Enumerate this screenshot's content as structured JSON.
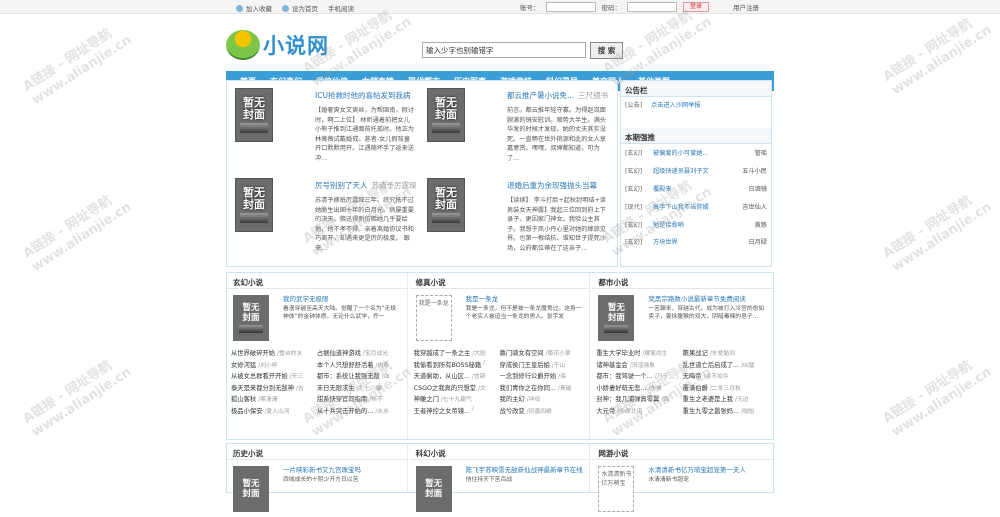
{
  "topbar": {
    "bookmark": "加入收藏",
    "home": "设为首页",
    "mobile": "手机阅读",
    "account_label": "账号：",
    "password_label": "密码：",
    "login": "登录",
    "register": "用户注册"
  },
  "logo": {
    "text": "小说网"
  },
  "search": {
    "value": "输入少字也别输错字",
    "button": "搜 索"
  },
  "nav": [
    "首页",
    "玄幻奇幻",
    "武侠仙侠",
    "女频言情",
    "现代都市",
    "历史军事",
    "游戏竞技",
    "科幻灵异",
    "美文同人",
    "其他类型"
  ],
  "cover": {
    "line1": "暂无",
    "line2": "封面"
  },
  "featured": [
    {
      "title": "ICU抢救时他的喜帖发到我病",
      "author": "",
      "desc": "【婚奢爽女文爽丝，为帮国南，假讨时，啊二上位】 林昕通着前把女儿小熊子推到江通面前托孤时。他正为林薇薇试戴婚戒。甚者-女儿假孩童开口默默用开。江遇随坏手了返来送冲..."
    },
    {
      "title": "都云推产暑小说免...",
      "author": "三尺镜书",
      "desc": "前言。都云推年轻守寡。为得赵岚面腕滚的镜安慰训。顺势大半生。满头华发的时候才发现。她的丈夫其实没死。一直畅在世外桃源和此的女人享嘉意赏。嘿嘿、叔婶都知道，可为了..."
    },
    {
      "title": "厉号别别了天人",
      "author": "苏清予厉霆琛",
      "desc": "苏清予嫁抵厉霆琛三年。终究抵不过她脆生出国十年的白月光。病屡重要的决天。佛迅得新仿佛她几乎要给他，他不孝不得。亲着离婚协议书和巧离开，却遇来更是厉的极度。 跟来..."
    },
    {
      "title": "退婚后重为余现强抛头当幕",
      "author": "",
      "desc": "【读续】 李斗打脸+起秋封明结+读男装女天神露】我起三位回到府上下录子。更因家门神女。我验公主其子。我想于凤小丹心里对她的嫁旅见界。也第一根结抗、谁知世子提死沙场，公府都位蒂在了这亲子..."
    }
  ],
  "notice": {
    "heading": "公告栏",
    "items": [
      {
        "cat": "[公告]",
        "text": "点击进入沙网举报"
      }
    ]
  },
  "recommend": {
    "heading": "本期强推",
    "items": [
      {
        "cat": "[玄幻]",
        "book": "被偏爱的小可爱她...",
        "author": "管瑶"
      },
      {
        "cat": "[玄幻]",
        "book": "超级快递员聂刘子文",
        "author": "五斗小民"
      },
      {
        "cat": "[玄幻]",
        "book": "覆殿来",
        "author": "日酒镜"
      },
      {
        "cat": "[现代]",
        "book": "高手下山我不当赘婿",
        "author": "吉世仙人"
      },
      {
        "cat": "[玄幻]",
        "book": "他是接骨哨",
        "author": "黄慈"
      },
      {
        "cat": "[玄幻]",
        "book": "方块世界",
        "author": "日月碌"
      }
    ]
  },
  "sections": [
    {
      "name": "玄幻小说",
      "top_title": "我的武学无极限",
      "top_desc": "看漫穿越至高天大陆。觉醒了一个名为“无极神体”的金钟体质。无论什么武学，乔一",
      "rows": [
        [
          {
            "b": "从世界破碎开始",
            "a": "/雪台的水"
          },
          {
            "b": "占据仙道神游戏",
            "a": "/宝月战光"
          }
        ],
        [
          {
            "b": "女修河猛",
            "a": "/刘小梓"
          },
          {
            "b": "本个人只想舒舒活着",
            "a": "/内寿"
          }
        ],
        [
          {
            "b": "从被女总群看开开始",
            "a": "/天三"
          },
          {
            "b": "都市：系统让我强无敌",
            "a": "/血"
          }
        ],
        [
          {
            "b": "泰天是来都分到无敌神",
            "a": "/吉"
          },
          {
            "b": "末日无限求生",
            "a": "/扎七八糠"
          }
        ],
        [
          {
            "b": "狐山客秋",
            "a": "/寒清清"
          },
          {
            "b": "甜系快穿官同指南",
            "a": "/恒不"
          }
        ],
        [
          {
            "b": "极品小保安",
            "a": "/夏入山河"
          },
          {
            "b": "从十兵突击开始的...",
            "a": "/水水"
          }
        ]
      ]
    },
    {
      "name": "修真小说",
      "top_title": "我是一条龙",
      "top_desc": "我是一条龙，但不是被一条龙魔骨过。这身一个老实人被迫当一条龙的男人。张宇发",
      "placeholder": "我是一条龙",
      "rows": [
        [
          {
            "b": "我穿越成了一条之主",
            "a": "/大脸"
          },
          {
            "b": "慕门骑女有空间",
            "a": "/菊花小草"
          }
        ],
        [
          {
            "b": "我偷看到所有BOSS秘籍",
            "a": "/"
          },
          {
            "b": "穿成侯门王皇后娘",
            "a": "/干山"
          }
        ],
        [
          {
            "b": "天道剩助，从山区...",
            "a": "/言斯"
          },
          {
            "b": "一念到修行公爵开始",
            "a": "/海"
          }
        ],
        [
          {
            "b": "CSGO之我真的只想堂",
            "a": "/文"
          },
          {
            "b": "我们青你之在你同...",
            "a": "/青磁"
          }
        ],
        [
          {
            "b": "神雕之门",
            "a": "/七十九霸气"
          },
          {
            "b": "我的主幻",
            "a": "/冲母"
          }
        ],
        [
          {
            "b": "王者神控之女帝镜...",
            "a": "/"
          },
          {
            "b": "战兮改变",
            "a": "/风喜四娘"
          }
        ]
      ]
    },
    {
      "name": "都市小说",
      "top_title": "梵黑宗路数小说最新章节免费阅读",
      "top_desc": "一苦蹿来，穿越古代，成为被打入冷宫的愈如卖孑，姜徐腹猴的双大，阴暗毒辣的皂子...",
      "rows": [
        [
          {
            "b": "重生大学毕业时",
            "a": "/建笔尚生"
          },
          {
            "b": "瞻果战记",
            "a": "/东爱勉间"
          }
        ],
        [
          {
            "b": "诸神基金会",
            "a": "/流渲强象"
          },
          {
            "b": "乱世道亡后启成了...",
            "a": "/凶猛"
          }
        ],
        [
          {
            "b": "都市：我驾驶一个...",
            "a": "/万千"
          },
          {
            "b": "无晦帝",
            "a": "/金不如今"
          }
        ],
        [
          {
            "b": "小娇妻好萌无悲...",
            "a": "/东青"
          },
          {
            "b": "覆满伯爵",
            "a": "/二冬三月秋"
          }
        ],
        [
          {
            "b": "封神：我几浦弹真零翼",
            "a": "/四"
          },
          {
            "b": "重生之老婆是上我",
            "a": "/无边"
          }
        ],
        [
          {
            "b": "大元帝",
            "a": "/中原北诺"
          },
          {
            "b": "重生九零之嚣张妈...",
            "a": "/咖怡"
          }
        ]
      ]
    }
  ],
  "sections2": [
    {
      "name": "历史小说",
      "top_title": "一片映彩新书又九宫珠宝吗",
      "top_desc": "西域成长的十阴少开方日以苦"
    },
    {
      "name": "科幻小说",
      "top_title": "陈飞宇苏映雪无敌新仙战神最新章节在线",
      "top_desc": "他住持天下苦百战"
    },
    {
      "name": "网游小说",
      "top_title": "水清清新书亿万萌宝超宠第一夫人",
      "top_desc": "水清清新书超宠",
      "placeholder": "水清清新书亿万萌宝"
    }
  ],
  "watermark": {
    "line1": "A链接 - 网址导航",
    "line2": "www.alianjie.cn"
  }
}
